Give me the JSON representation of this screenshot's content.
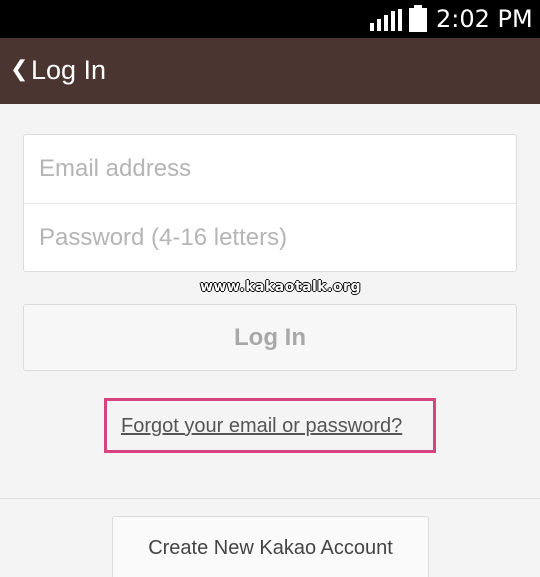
{
  "status_bar": {
    "time": "2:02 PM",
    "signal_icon": "signal-strength-icon",
    "battery_icon": "battery-icon"
  },
  "header": {
    "back_icon": "back-chevron-icon",
    "back_glyph": "❮",
    "title": "Log In",
    "background_color": "#4b3530"
  },
  "form": {
    "email_placeholder": "Email address",
    "password_placeholder": "Password (4-16 letters)"
  },
  "watermark": "www.kakaotalk.org",
  "login_button_label": "Log In",
  "forgot_link": "Forgot your email or password?",
  "highlight_color": "#d6437f",
  "create_account_label": "Create New Kakao Account"
}
